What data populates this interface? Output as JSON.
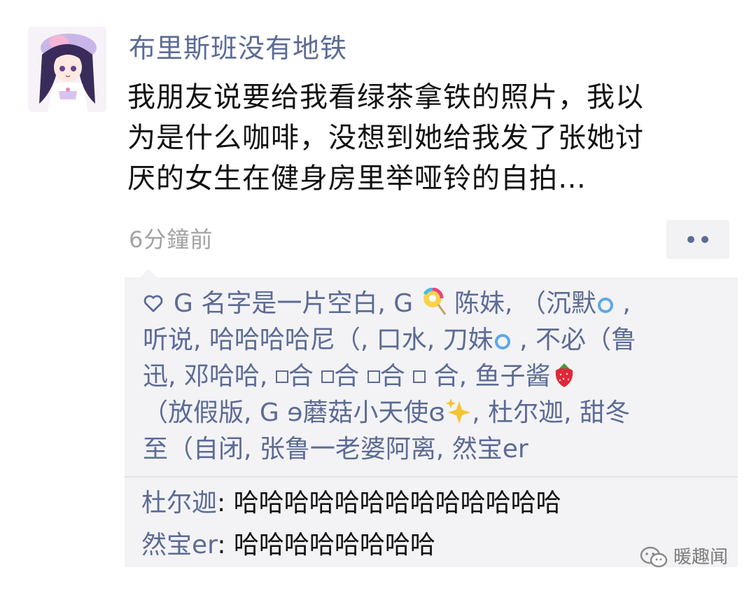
{
  "post": {
    "username": "布里斯班没有地铁",
    "content_lines": [
      "我朋友说要给我看绿茶拿铁的照片，我以",
      "为是什么咖啡，没想到她给我发了张她讨",
      "厌的女生在健身房里举哑铃的自拍…"
    ],
    "timestamp": "6分鐘前"
  },
  "likes": {
    "line1": {
      "a": "G 名字是一片空白, G",
      "b": " 陈妹, （沉默",
      "c": " ,"
    },
    "line2": {
      "a": "听说, 哈哈哈哈尼（, 口水, 刀妹",
      "b": " , 不必（鲁"
    },
    "line3": {
      "a": "迅, 邓哈哈, ",
      "b1": "合  ",
      "b2": "合  ",
      "b3": "合  ",
      "b4": " 合, 鱼子酱"
    },
    "line4": {
      "a": "（放假版, G ɘ蘑菇小天使ɞ",
      "b": ", 杜尔迦, 甜冬"
    },
    "line5": "至（自闭, 张鲁一老婆阿离, 然宝er"
  },
  "comments": [
    {
      "author": "杜尔迦",
      "text": "哈哈哈哈哈哈哈哈哈哈哈哈哈"
    },
    {
      "author": "然宝er",
      "text": "哈哈哈哈哈哈哈哈"
    }
  ],
  "watermark": {
    "label": "暖趣闻"
  },
  "colors": {
    "name_blue": "#5c6b96",
    "timestamp_gray": "#a3a3a3",
    "box_bg": "#f3f3f5"
  },
  "icons": [
    "avatar",
    "more-dots-icon",
    "heart-icon",
    "lollipop-icon",
    "ring-icon",
    "strawberry-icon",
    "sparkles-icon",
    "wechat-icon"
  ]
}
